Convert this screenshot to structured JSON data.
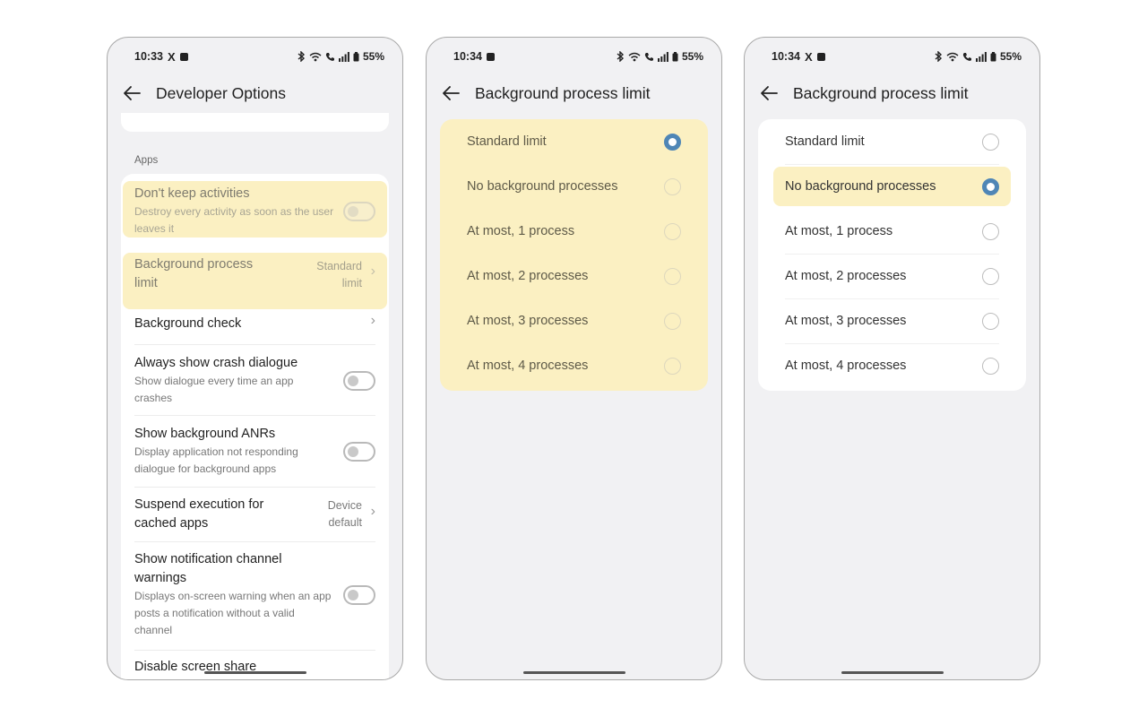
{
  "status": {
    "p1_time": "10:33",
    "p2_time": "10:34",
    "p3_time": "10:34",
    "x_glyph": "X",
    "battery": "55%"
  },
  "panel1": {
    "title": "Developer Options",
    "section": "Apps",
    "rows": [
      {
        "title": "Don't keep activities",
        "subtitle": "Destroy every activity as soon as the user leaves it"
      },
      {
        "title": "Background process limit",
        "value": "Standard limit"
      },
      {
        "title": "Background check"
      },
      {
        "title": "Always show crash dialogue",
        "subtitle": "Show dialogue every time an app crashes"
      },
      {
        "title": "Show background ANRs",
        "subtitle": "Display application not responding dialogue for background apps"
      },
      {
        "title": "Suspend execution for cached apps",
        "value": "Device default"
      },
      {
        "title": "Show notification channel warnings",
        "subtitle": "Displays on-screen warning when an app posts a notification without a valid channel"
      },
      {
        "title": "Disable screen share"
      }
    ]
  },
  "panel2": {
    "title": "Background process limit",
    "selected_index": 0,
    "options": [
      "Standard limit",
      "No background processes",
      "At most, 1 process",
      "At most, 2 processes",
      "At most, 3 processes",
      "At most, 4 processes"
    ]
  },
  "panel3": {
    "title": "Background process limit",
    "selected_index": 1,
    "options": [
      "Standard limit",
      "No background processes",
      "At most, 1 process",
      "At most, 2 processes",
      "At most, 3 processes",
      "At most, 4 processes"
    ]
  },
  "colors": {
    "highlight": "#fbf0c2",
    "radio_selected": "#4f86b6",
    "screen_bg": "#f1f1f3"
  }
}
